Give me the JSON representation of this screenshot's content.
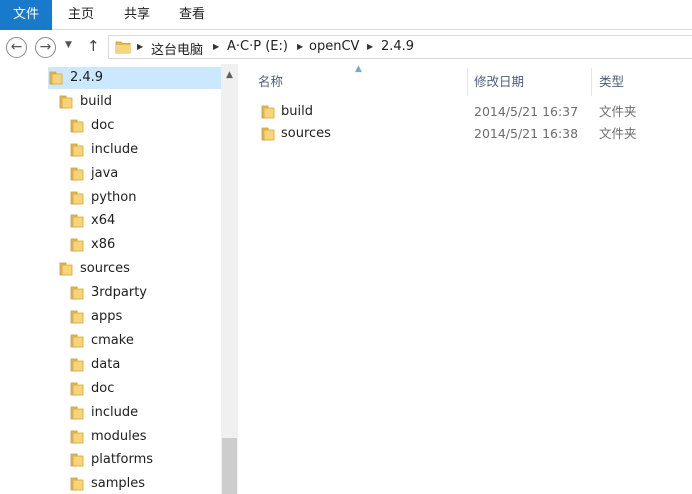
{
  "ribbon": {
    "tabs": [
      "文件",
      "主页",
      "共享",
      "查看"
    ]
  },
  "navigation": {
    "back_icon": "back-arrow-icon",
    "forward_icon": "forward-arrow-icon",
    "recent_icon": "chevron-down-icon",
    "up_icon": "up-arrow-icon"
  },
  "address": {
    "crumbs": [
      "这台电脑",
      "A·C·P (E:)",
      "openCV",
      "2.4.9"
    ]
  },
  "tree": [
    {
      "label": "2.4.9",
      "level": 0,
      "selected": true
    },
    {
      "label": "build",
      "level": 1
    },
    {
      "label": "doc",
      "level": 2
    },
    {
      "label": "include",
      "level": 2
    },
    {
      "label": "java",
      "level": 2
    },
    {
      "label": "python",
      "level": 2
    },
    {
      "label": "x64",
      "level": 2
    },
    {
      "label": "x86",
      "level": 2
    },
    {
      "label": "sources",
      "level": 1
    },
    {
      "label": "3rdparty",
      "level": 2
    },
    {
      "label": "apps",
      "level": 2
    },
    {
      "label": "cmake",
      "level": 2
    },
    {
      "label": "data",
      "level": 2
    },
    {
      "label": "doc",
      "level": 2
    },
    {
      "label": "include",
      "level": 2
    },
    {
      "label": "modules",
      "level": 2
    },
    {
      "label": "platforms",
      "level": 2
    },
    {
      "label": "samples",
      "level": 2
    }
  ],
  "columns": {
    "name": "名称",
    "date": "修改日期",
    "type": "类型"
  },
  "files": [
    {
      "name": "build",
      "date": "2014/5/21 16:37",
      "type": "文件夹"
    },
    {
      "name": "sources",
      "date": "2014/5/21 16:38",
      "type": "文件夹"
    }
  ],
  "colors": {
    "file_tab": "#1979ca",
    "folder": "#e8b84a",
    "header_text": "#4c607a",
    "selection": "#cce8ff"
  }
}
